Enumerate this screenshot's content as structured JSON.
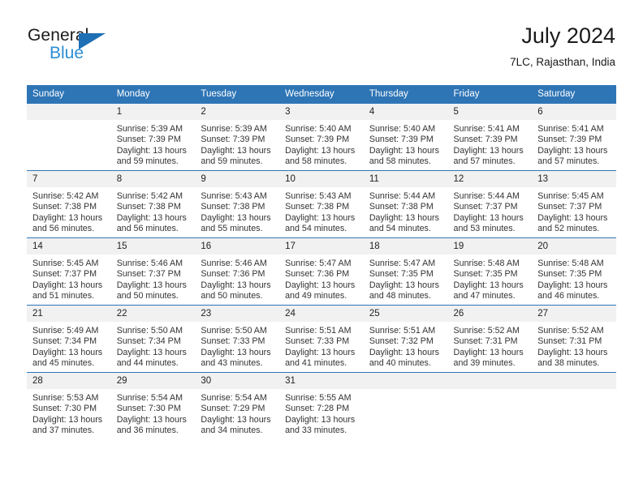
{
  "logo": {
    "word_top": "General",
    "word_bottom": "Blue",
    "triangle_color": "#1f6fb5",
    "blue_color": "#2d8ed6"
  },
  "header": {
    "title": "July 2024",
    "subtitle": "7LC, Rajasthan, India"
  },
  "theme": {
    "header_blue": "#2e75b6",
    "daynum_gray": "#f1f1f1"
  },
  "weekday_headers": [
    "Sunday",
    "Monday",
    "Tuesday",
    "Wednesday",
    "Thursday",
    "Friday",
    "Saturday"
  ],
  "weeks": [
    [
      {
        "day": "",
        "sunrise": "",
        "sunset": "",
        "daylight1": "",
        "daylight2": ""
      },
      {
        "day": "1",
        "sunrise": "Sunrise: 5:39 AM",
        "sunset": "Sunset: 7:39 PM",
        "daylight1": "Daylight: 13 hours",
        "daylight2": "and 59 minutes."
      },
      {
        "day": "2",
        "sunrise": "Sunrise: 5:39 AM",
        "sunset": "Sunset: 7:39 PM",
        "daylight1": "Daylight: 13 hours",
        "daylight2": "and 59 minutes."
      },
      {
        "day": "3",
        "sunrise": "Sunrise: 5:40 AM",
        "sunset": "Sunset: 7:39 PM",
        "daylight1": "Daylight: 13 hours",
        "daylight2": "and 58 minutes."
      },
      {
        "day": "4",
        "sunrise": "Sunrise: 5:40 AM",
        "sunset": "Sunset: 7:39 PM",
        "daylight1": "Daylight: 13 hours",
        "daylight2": "and 58 minutes."
      },
      {
        "day": "5",
        "sunrise": "Sunrise: 5:41 AM",
        "sunset": "Sunset: 7:39 PM",
        "daylight1": "Daylight: 13 hours",
        "daylight2": "and 57 minutes."
      },
      {
        "day": "6",
        "sunrise": "Sunrise: 5:41 AM",
        "sunset": "Sunset: 7:39 PM",
        "daylight1": "Daylight: 13 hours",
        "daylight2": "and 57 minutes."
      }
    ],
    [
      {
        "day": "7",
        "sunrise": "Sunrise: 5:42 AM",
        "sunset": "Sunset: 7:38 PM",
        "daylight1": "Daylight: 13 hours",
        "daylight2": "and 56 minutes."
      },
      {
        "day": "8",
        "sunrise": "Sunrise: 5:42 AM",
        "sunset": "Sunset: 7:38 PM",
        "daylight1": "Daylight: 13 hours",
        "daylight2": "and 56 minutes."
      },
      {
        "day": "9",
        "sunrise": "Sunrise: 5:43 AM",
        "sunset": "Sunset: 7:38 PM",
        "daylight1": "Daylight: 13 hours",
        "daylight2": "and 55 minutes."
      },
      {
        "day": "10",
        "sunrise": "Sunrise: 5:43 AM",
        "sunset": "Sunset: 7:38 PM",
        "daylight1": "Daylight: 13 hours",
        "daylight2": "and 54 minutes."
      },
      {
        "day": "11",
        "sunrise": "Sunrise: 5:44 AM",
        "sunset": "Sunset: 7:38 PM",
        "daylight1": "Daylight: 13 hours",
        "daylight2": "and 54 minutes."
      },
      {
        "day": "12",
        "sunrise": "Sunrise: 5:44 AM",
        "sunset": "Sunset: 7:37 PM",
        "daylight1": "Daylight: 13 hours",
        "daylight2": "and 53 minutes."
      },
      {
        "day": "13",
        "sunrise": "Sunrise: 5:45 AM",
        "sunset": "Sunset: 7:37 PM",
        "daylight1": "Daylight: 13 hours",
        "daylight2": "and 52 minutes."
      }
    ],
    [
      {
        "day": "14",
        "sunrise": "Sunrise: 5:45 AM",
        "sunset": "Sunset: 7:37 PM",
        "daylight1": "Daylight: 13 hours",
        "daylight2": "and 51 minutes."
      },
      {
        "day": "15",
        "sunrise": "Sunrise: 5:46 AM",
        "sunset": "Sunset: 7:37 PM",
        "daylight1": "Daylight: 13 hours",
        "daylight2": "and 50 minutes."
      },
      {
        "day": "16",
        "sunrise": "Sunrise: 5:46 AM",
        "sunset": "Sunset: 7:36 PM",
        "daylight1": "Daylight: 13 hours",
        "daylight2": "and 50 minutes."
      },
      {
        "day": "17",
        "sunrise": "Sunrise: 5:47 AM",
        "sunset": "Sunset: 7:36 PM",
        "daylight1": "Daylight: 13 hours",
        "daylight2": "and 49 minutes."
      },
      {
        "day": "18",
        "sunrise": "Sunrise: 5:47 AM",
        "sunset": "Sunset: 7:35 PM",
        "daylight1": "Daylight: 13 hours",
        "daylight2": "and 48 minutes."
      },
      {
        "day": "19",
        "sunrise": "Sunrise: 5:48 AM",
        "sunset": "Sunset: 7:35 PM",
        "daylight1": "Daylight: 13 hours",
        "daylight2": "and 47 minutes."
      },
      {
        "day": "20",
        "sunrise": "Sunrise: 5:48 AM",
        "sunset": "Sunset: 7:35 PM",
        "daylight1": "Daylight: 13 hours",
        "daylight2": "and 46 minutes."
      }
    ],
    [
      {
        "day": "21",
        "sunrise": "Sunrise: 5:49 AM",
        "sunset": "Sunset: 7:34 PM",
        "daylight1": "Daylight: 13 hours",
        "daylight2": "and 45 minutes."
      },
      {
        "day": "22",
        "sunrise": "Sunrise: 5:50 AM",
        "sunset": "Sunset: 7:34 PM",
        "daylight1": "Daylight: 13 hours",
        "daylight2": "and 44 minutes."
      },
      {
        "day": "23",
        "sunrise": "Sunrise: 5:50 AM",
        "sunset": "Sunset: 7:33 PM",
        "daylight1": "Daylight: 13 hours",
        "daylight2": "and 43 minutes."
      },
      {
        "day": "24",
        "sunrise": "Sunrise: 5:51 AM",
        "sunset": "Sunset: 7:33 PM",
        "daylight1": "Daylight: 13 hours",
        "daylight2": "and 41 minutes."
      },
      {
        "day": "25",
        "sunrise": "Sunrise: 5:51 AM",
        "sunset": "Sunset: 7:32 PM",
        "daylight1": "Daylight: 13 hours",
        "daylight2": "and 40 minutes."
      },
      {
        "day": "26",
        "sunrise": "Sunrise: 5:52 AM",
        "sunset": "Sunset: 7:31 PM",
        "daylight1": "Daylight: 13 hours",
        "daylight2": "and 39 minutes."
      },
      {
        "day": "27",
        "sunrise": "Sunrise: 5:52 AM",
        "sunset": "Sunset: 7:31 PM",
        "daylight1": "Daylight: 13 hours",
        "daylight2": "and 38 minutes."
      }
    ],
    [
      {
        "day": "28",
        "sunrise": "Sunrise: 5:53 AM",
        "sunset": "Sunset: 7:30 PM",
        "daylight1": "Daylight: 13 hours",
        "daylight2": "and 37 minutes."
      },
      {
        "day": "29",
        "sunrise": "Sunrise: 5:54 AM",
        "sunset": "Sunset: 7:30 PM",
        "daylight1": "Daylight: 13 hours",
        "daylight2": "and 36 minutes."
      },
      {
        "day": "30",
        "sunrise": "Sunrise: 5:54 AM",
        "sunset": "Sunset: 7:29 PM",
        "daylight1": "Daylight: 13 hours",
        "daylight2": "and 34 minutes."
      },
      {
        "day": "31",
        "sunrise": "Sunrise: 5:55 AM",
        "sunset": "Sunset: 7:28 PM",
        "daylight1": "Daylight: 13 hours",
        "daylight2": "and 33 minutes."
      },
      {
        "day": "",
        "sunrise": "",
        "sunset": "",
        "daylight1": "",
        "daylight2": ""
      },
      {
        "day": "",
        "sunrise": "",
        "sunset": "",
        "daylight1": "",
        "daylight2": ""
      },
      {
        "day": "",
        "sunrise": "",
        "sunset": "",
        "daylight1": "",
        "daylight2": ""
      }
    ]
  ]
}
